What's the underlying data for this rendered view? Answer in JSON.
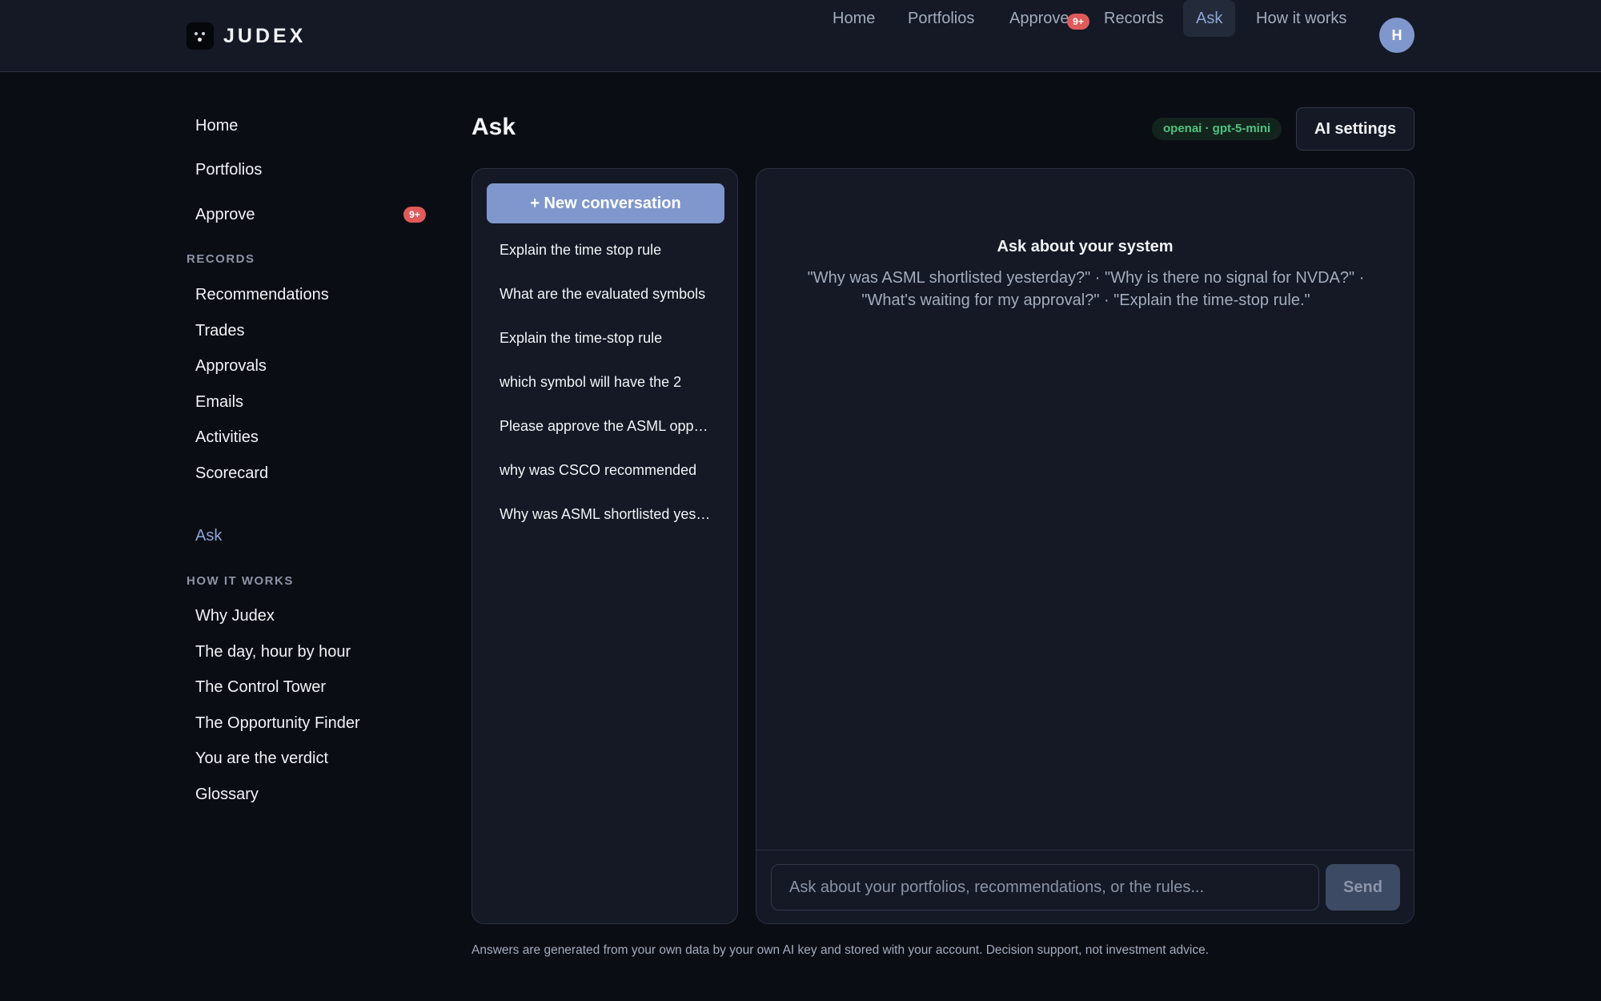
{
  "brand": {
    "name": "JUDEX"
  },
  "topnav": {
    "items": [
      {
        "label": "Home"
      },
      {
        "label": "Portfolios"
      },
      {
        "label": "Approve",
        "badge": "9+"
      },
      {
        "label": "Records"
      },
      {
        "label": "Ask",
        "active": true
      },
      {
        "label": "How it works"
      }
    ],
    "avatar_initial": "H"
  },
  "sidebar": {
    "primary": [
      {
        "label": "Home"
      },
      {
        "label": "Portfolios"
      },
      {
        "label": "Approve",
        "badge": "9+"
      }
    ],
    "records_heading": "RECORDS",
    "records": [
      {
        "label": "Recommendations"
      },
      {
        "label": "Trades"
      },
      {
        "label": "Approvals"
      },
      {
        "label": "Emails"
      },
      {
        "label": "Activities"
      },
      {
        "label": "Scorecard"
      }
    ],
    "ask_label": "Ask",
    "how_heading": "HOW IT WORKS",
    "how": [
      {
        "label": "Why Judex"
      },
      {
        "label": "The day, hour by hour"
      },
      {
        "label": "The Control Tower"
      },
      {
        "label": "The Opportunity Finder"
      },
      {
        "label": "You are the verdict"
      },
      {
        "label": "Glossary"
      }
    ]
  },
  "main": {
    "title": "Ask",
    "model": "openai · gpt-5-mini",
    "ai_settings_label": "AI settings",
    "new_conversation_label": "+ New conversation",
    "conversations": [
      "Explain the time stop rule",
      "What are the evaluated symbols",
      "Explain the time-stop rule",
      "which symbol will have the 2",
      "Please approve the ASML opportunity",
      "why was CSCO recommended",
      "Why was ASML shortlisted yesterday"
    ],
    "empty_title": "Ask about your system",
    "empty_hints": "\"Why was ASML shortlisted yesterday?\" · \"Why is there no signal for NVDA?\" · \"What's waiting for my approval?\" · \"Explain the time-stop rule.\"",
    "input_placeholder": "Ask about your portfolios, recommendations, or the rules...",
    "send_label": "Send",
    "disclaimer": "Answers are generated from your own data by your own AI key and stored with your account. Decision support, not investment advice."
  },
  "colors": {
    "background": "#0a0d14",
    "panel": "#141925",
    "accent": "#7f97cc",
    "badge": "#e05a5a",
    "model_green": "#4ec27f"
  }
}
